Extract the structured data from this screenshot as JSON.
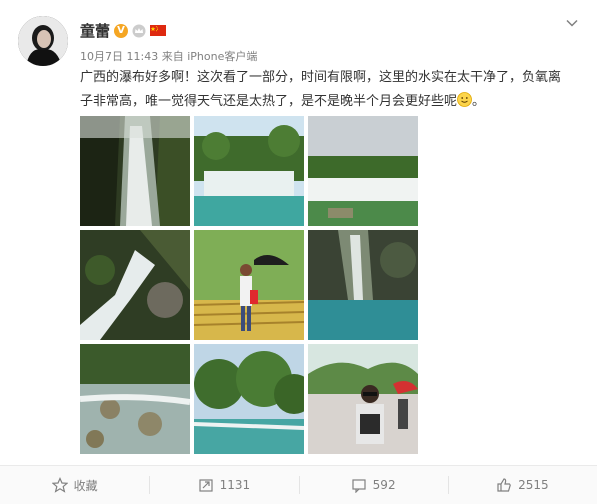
{
  "post": {
    "author": "童蕾",
    "meta_date": "10月7日 11:43",
    "meta_from": "来自",
    "meta_source": "iPhone客户端",
    "text": "广西的瀑布好多啊！这次看了一部分，时间有限啊，这里的水实在太干净了，负氧离子非常高，唯一觉得天气还是太热了，是不是晚半个月会更好些呢",
    "text_end": "。",
    "icons": {
      "verified": "verified-v-icon",
      "crown": "crown-icon",
      "flag": "china-flag-icon",
      "menu": "chevron-down-icon",
      "emoji": "smile-emoji-icon"
    },
    "badge_letter": "V"
  },
  "actions": {
    "favorite_label": "收藏",
    "repost_count": "1131",
    "comment_count": "592",
    "like_count": "2515"
  },
  "colors": {
    "badge": "#f5a623",
    "flag_red": "#de2910",
    "flag_star": "#ffde00",
    "muted_text": "#808080"
  }
}
